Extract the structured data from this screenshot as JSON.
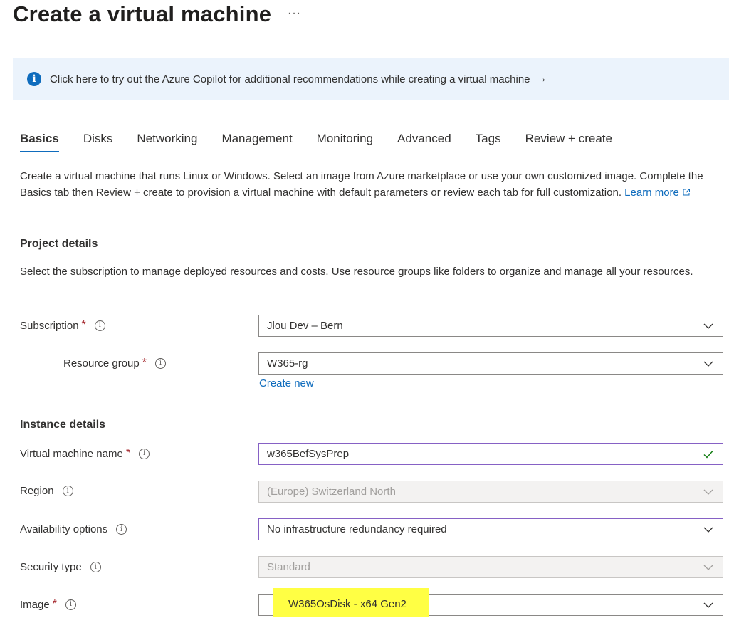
{
  "header": {
    "title": "Create a virtual machine",
    "more": "···"
  },
  "banner": {
    "text": "Click here to try out the Azure Copilot for additional recommendations while creating a virtual machine",
    "arrow": "→",
    "icon": "info-icon"
  },
  "tabs": [
    {
      "label": "Basics"
    },
    {
      "label": "Disks"
    },
    {
      "label": "Networking"
    },
    {
      "label": "Management"
    },
    {
      "label": "Monitoring"
    },
    {
      "label": "Advanced"
    },
    {
      "label": "Tags"
    },
    {
      "label": "Review + create"
    }
  ],
  "active_tab": "Basics",
  "description": {
    "text": "Create a virtual machine that runs Linux or Windows. Select an image from Azure marketplace or use your own customized image. Complete the Basics tab then Review + create to provision a virtual machine with default parameters or review each tab for full customization.",
    "learn_more": "Learn more"
  },
  "project": {
    "title": "Project details",
    "desc": "Select the subscription to manage deployed resources and costs. Use resource groups like folders to organize and manage all your resources.",
    "subscription_label": "Subscription",
    "subscription_value": "Jlou Dev – Bern",
    "resource_group_label": "Resource group",
    "resource_group_value": "W365-rg",
    "create_new": "Create new"
  },
  "instance": {
    "title": "Instance details",
    "vm_name_label": "Virtual machine name",
    "vm_name_value": "w365BefSysPrep",
    "region_label": "Region",
    "region_value": "(Europe) Switzerland North",
    "availability_label": "Availability options",
    "availability_value": "No infrastructure redundancy required",
    "security_label": "Security type",
    "security_value": "Standard",
    "image_label": "Image",
    "image_value": "W365OsDisk - x64 Gen2"
  },
  "required_mark": "*",
  "info_glyph": "i",
  "colors": {
    "accent": "#0f6cbd",
    "required": "#a4262c",
    "banner_bg": "#ebf3fc",
    "highlight": "#ffff44",
    "valid": "#107c10"
  }
}
